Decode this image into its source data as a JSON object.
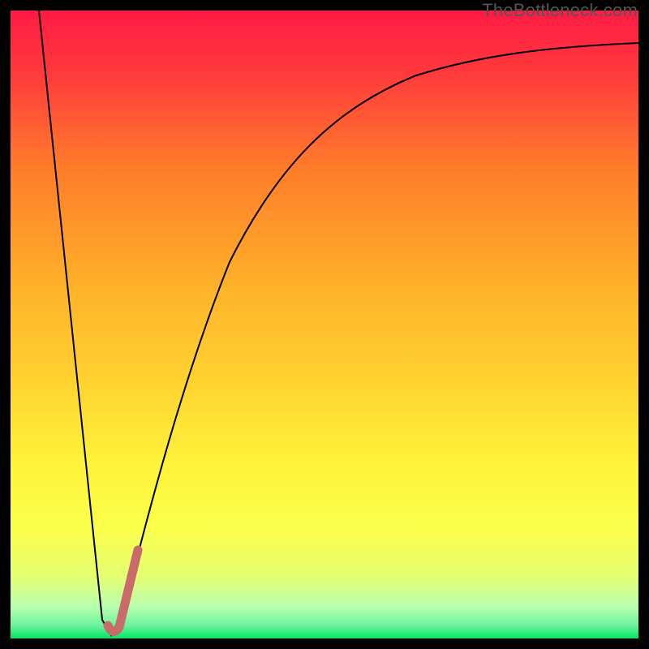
{
  "watermark": "TheBottleneck.com",
  "chart_data": {
    "type": "line",
    "title": "",
    "xlabel": "",
    "ylabel": "",
    "xlim": [
      0,
      100
    ],
    "ylim": [
      0,
      100
    ],
    "background_gradient": {
      "top_color": "#ff1a44",
      "mid_colors": [
        "#ff7c2a",
        "#ffd531",
        "#fff93e",
        "#f3ff5a"
      ],
      "bottom_color": "#00e865"
    },
    "series": [
      {
        "name": "bottleneck-curve",
        "color": "#000000",
        "stroke_width": 2,
        "points": [
          {
            "x": 4.5,
            "y": 100
          },
          {
            "x": 14.5,
            "y": 3
          },
          {
            "x": 16,
            "y": 0.5
          },
          {
            "x": 18,
            "y": 4
          },
          {
            "x": 22,
            "y": 20
          },
          {
            "x": 28,
            "y": 42
          },
          {
            "x": 35,
            "y": 60
          },
          {
            "x": 45,
            "y": 75
          },
          {
            "x": 55,
            "y": 83
          },
          {
            "x": 65,
            "y": 88
          },
          {
            "x": 75,
            "y": 91
          },
          {
            "x": 85,
            "y": 93
          },
          {
            "x": 95,
            "y": 94.5
          },
          {
            "x": 100,
            "y": 95
          }
        ]
      },
      {
        "name": "highlight-segment",
        "color": "#c96b6b",
        "stroke_width": 10,
        "points": [
          {
            "x": 15.5,
            "y": 2
          },
          {
            "x": 16.5,
            "y": 0.8
          },
          {
            "x": 18,
            "y": 4
          },
          {
            "x": 20.3,
            "y": 14
          }
        ]
      }
    ]
  }
}
